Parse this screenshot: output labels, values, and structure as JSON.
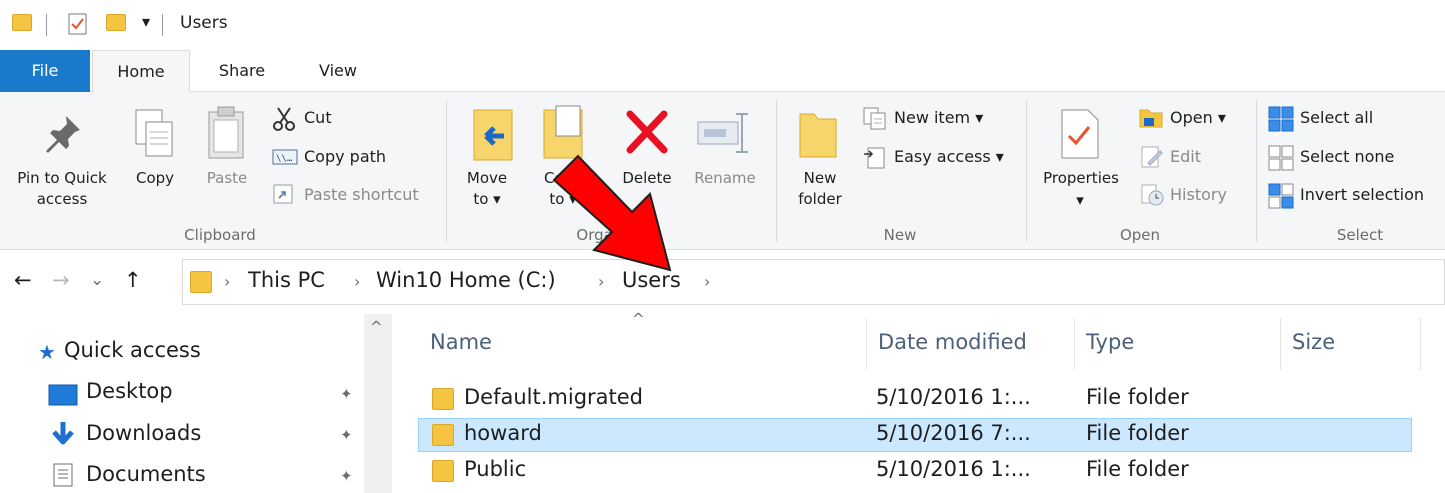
{
  "window": {
    "title": "Users",
    "qat_dropdown": "▾"
  },
  "tabs": [
    {
      "label": "File"
    },
    {
      "label": "Home"
    },
    {
      "label": "Share"
    },
    {
      "label": "View"
    }
  ],
  "ribbon": {
    "clipboard": {
      "label": "Clipboard",
      "pin_line1": "Pin to Quick",
      "pin_line2": "access",
      "copy": "Copy",
      "paste": "Paste",
      "cut": "Cut",
      "copy_path": "Copy path",
      "paste_shortcut": "Paste shortcut"
    },
    "organize": {
      "label": "Organize",
      "move_line1": "Move",
      "move_line2": "to ▾",
      "copy_line1": "Copy",
      "copy_line2": "to ▾",
      "delete": "Delete",
      "delete_caret": "▾",
      "rename": "Rename"
    },
    "new": {
      "label": "New",
      "new_folder_line1": "New",
      "new_folder_line2": "folder",
      "new_item": "New item ▾",
      "easy_access": "Easy access ▾"
    },
    "open": {
      "label": "Open",
      "properties": "Properties",
      "properties_caret": "▾",
      "open": "Open ▾",
      "edit": "Edit",
      "history": "History"
    },
    "select": {
      "label": "Select",
      "select_all": "Select all",
      "select_none": "Select none",
      "invert_selection": "Invert selection"
    }
  },
  "address_bar": {
    "back": "←",
    "forward": "→",
    "recent": "⌄",
    "up": "↑",
    "separator": "›",
    "crumbs": [
      "This PC",
      "Win10 Home (C:)",
      "Users"
    ]
  },
  "nav_pane": {
    "items": [
      {
        "label": "Quick access"
      },
      {
        "label": "Desktop"
      },
      {
        "label": "Downloads"
      },
      {
        "label": "Documents"
      }
    ],
    "pin_glyph": "✦",
    "scroll_up": "^"
  },
  "file_list": {
    "sort_arrow": "^",
    "columns": [
      "Name",
      "Date modified",
      "Type",
      "Size"
    ],
    "rows": [
      {
        "name": "Default.migrated",
        "date": "5/10/2016 1:...",
        "type": "File folder",
        "size": ""
      },
      {
        "name": "howard",
        "date": "5/10/2016 7:...",
        "type": "File folder",
        "size": ""
      },
      {
        "name": "Public",
        "date": "5/10/2016 1:...",
        "type": "File folder",
        "size": ""
      }
    ]
  },
  "colors": {
    "file_tab": "#1979ca",
    "selection": "#cce8ff",
    "folder": "#f5c542",
    "delete_x": "#e81123",
    "annotation_arrow": "#ff0000"
  }
}
